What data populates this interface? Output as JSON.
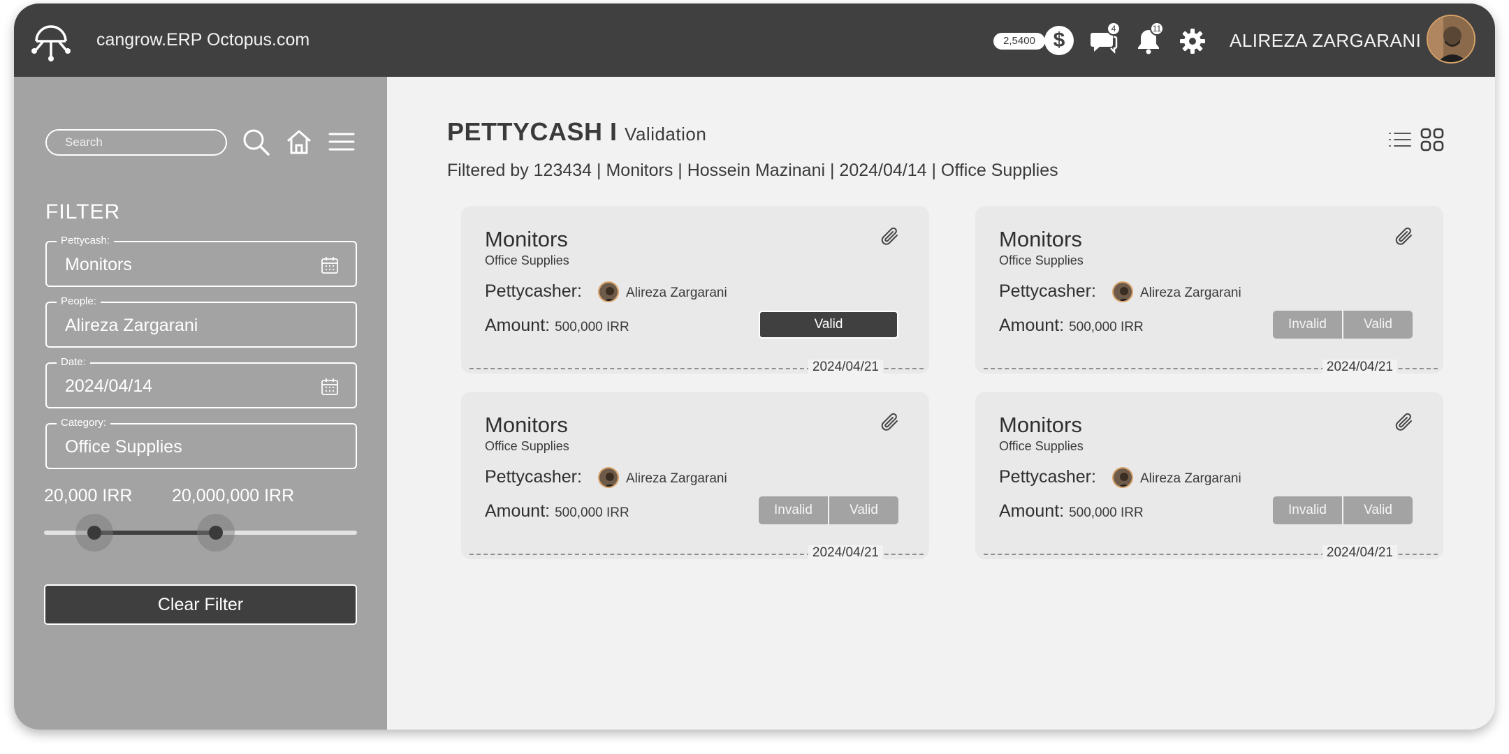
{
  "header": {
    "app_title": "cangrow.ERP Octopus.com",
    "credits": "2,5400",
    "messages_count": "4",
    "notifications_count": "11",
    "user_name": "ALIREZA ZARGARANI"
  },
  "sidebar": {
    "search_placeholder": "Search",
    "filter_title": "FILTER",
    "fields": [
      {
        "label": "Pettycash:",
        "value": "Monitors"
      },
      {
        "label": "People:",
        "value": "Alireza Zargarani"
      },
      {
        "label": "Date:",
        "value": "2024/04/14"
      },
      {
        "label": "Category:",
        "value": "Office Supplies"
      }
    ],
    "range": {
      "min_label": "20,000 IRR",
      "max_label": "20,000,000 IRR",
      "low_fraction": 0.16,
      "high_fraction": 0.55
    },
    "clear_label": "Clear Filter"
  },
  "main": {
    "title": "PETTYCASH I",
    "subtitle": "Validation",
    "filtered_by": "Filtered by 123434 | Monitors | Hossein Mazinani | 2024/04/14 | Office Supplies",
    "cards": [
      {
        "title": "Monitors",
        "category": "Office Supplies",
        "pettycasher_label": "Pettycasher:",
        "pettycasher": "Alireza Zargarani",
        "amount_label": "Amount:",
        "amount": "500,000 IRR",
        "valid_label": "Valid",
        "invalid_label": "",
        "date": "2024/04/21",
        "state": "valid"
      },
      {
        "title": "Monitors",
        "category": "Office Supplies",
        "pettycasher_label": "Pettycasher:",
        "pettycasher": "Alireza Zargarani",
        "amount_label": "Amount:",
        "amount": "500,000 IRR",
        "valid_label": "Valid",
        "invalid_label": "Invalid",
        "date": "2024/04/21",
        "state": "pending"
      },
      {
        "title": "Monitors",
        "category": "Office Supplies",
        "pettycasher_label": "Pettycasher:",
        "pettycasher": "Alireza Zargarani",
        "amount_label": "Amount:",
        "amount": "500,000 IRR",
        "valid_label": "Valid",
        "invalid_label": "Invalid",
        "date": "2024/04/21",
        "state": "pending"
      },
      {
        "title": "Monitors",
        "category": "Office Supplies",
        "pettycasher_label": "Pettycasher:",
        "pettycasher": "Alireza Zargarani",
        "amount_label": "Amount:",
        "amount": "500,000 IRR",
        "valid_label": "Valid",
        "invalid_label": "Invalid",
        "date": "2024/04/21",
        "state": "pending"
      }
    ]
  },
  "icons": [
    "octopus-logo-icon",
    "dollar-icon",
    "chat-icon",
    "bell-icon",
    "gear-icon",
    "search-icon",
    "home-icon",
    "menu-icon",
    "calendar-icon",
    "list-view-icon",
    "grid-view-icon",
    "paperclip-icon"
  ],
  "colors": {
    "header": "#404040",
    "sidebar": "#a3a3a3",
    "main": "#f2f2f2",
    "card": "#e9e9e9",
    "button_dark": "#404040",
    "button_muted": "#a3a3a3"
  }
}
